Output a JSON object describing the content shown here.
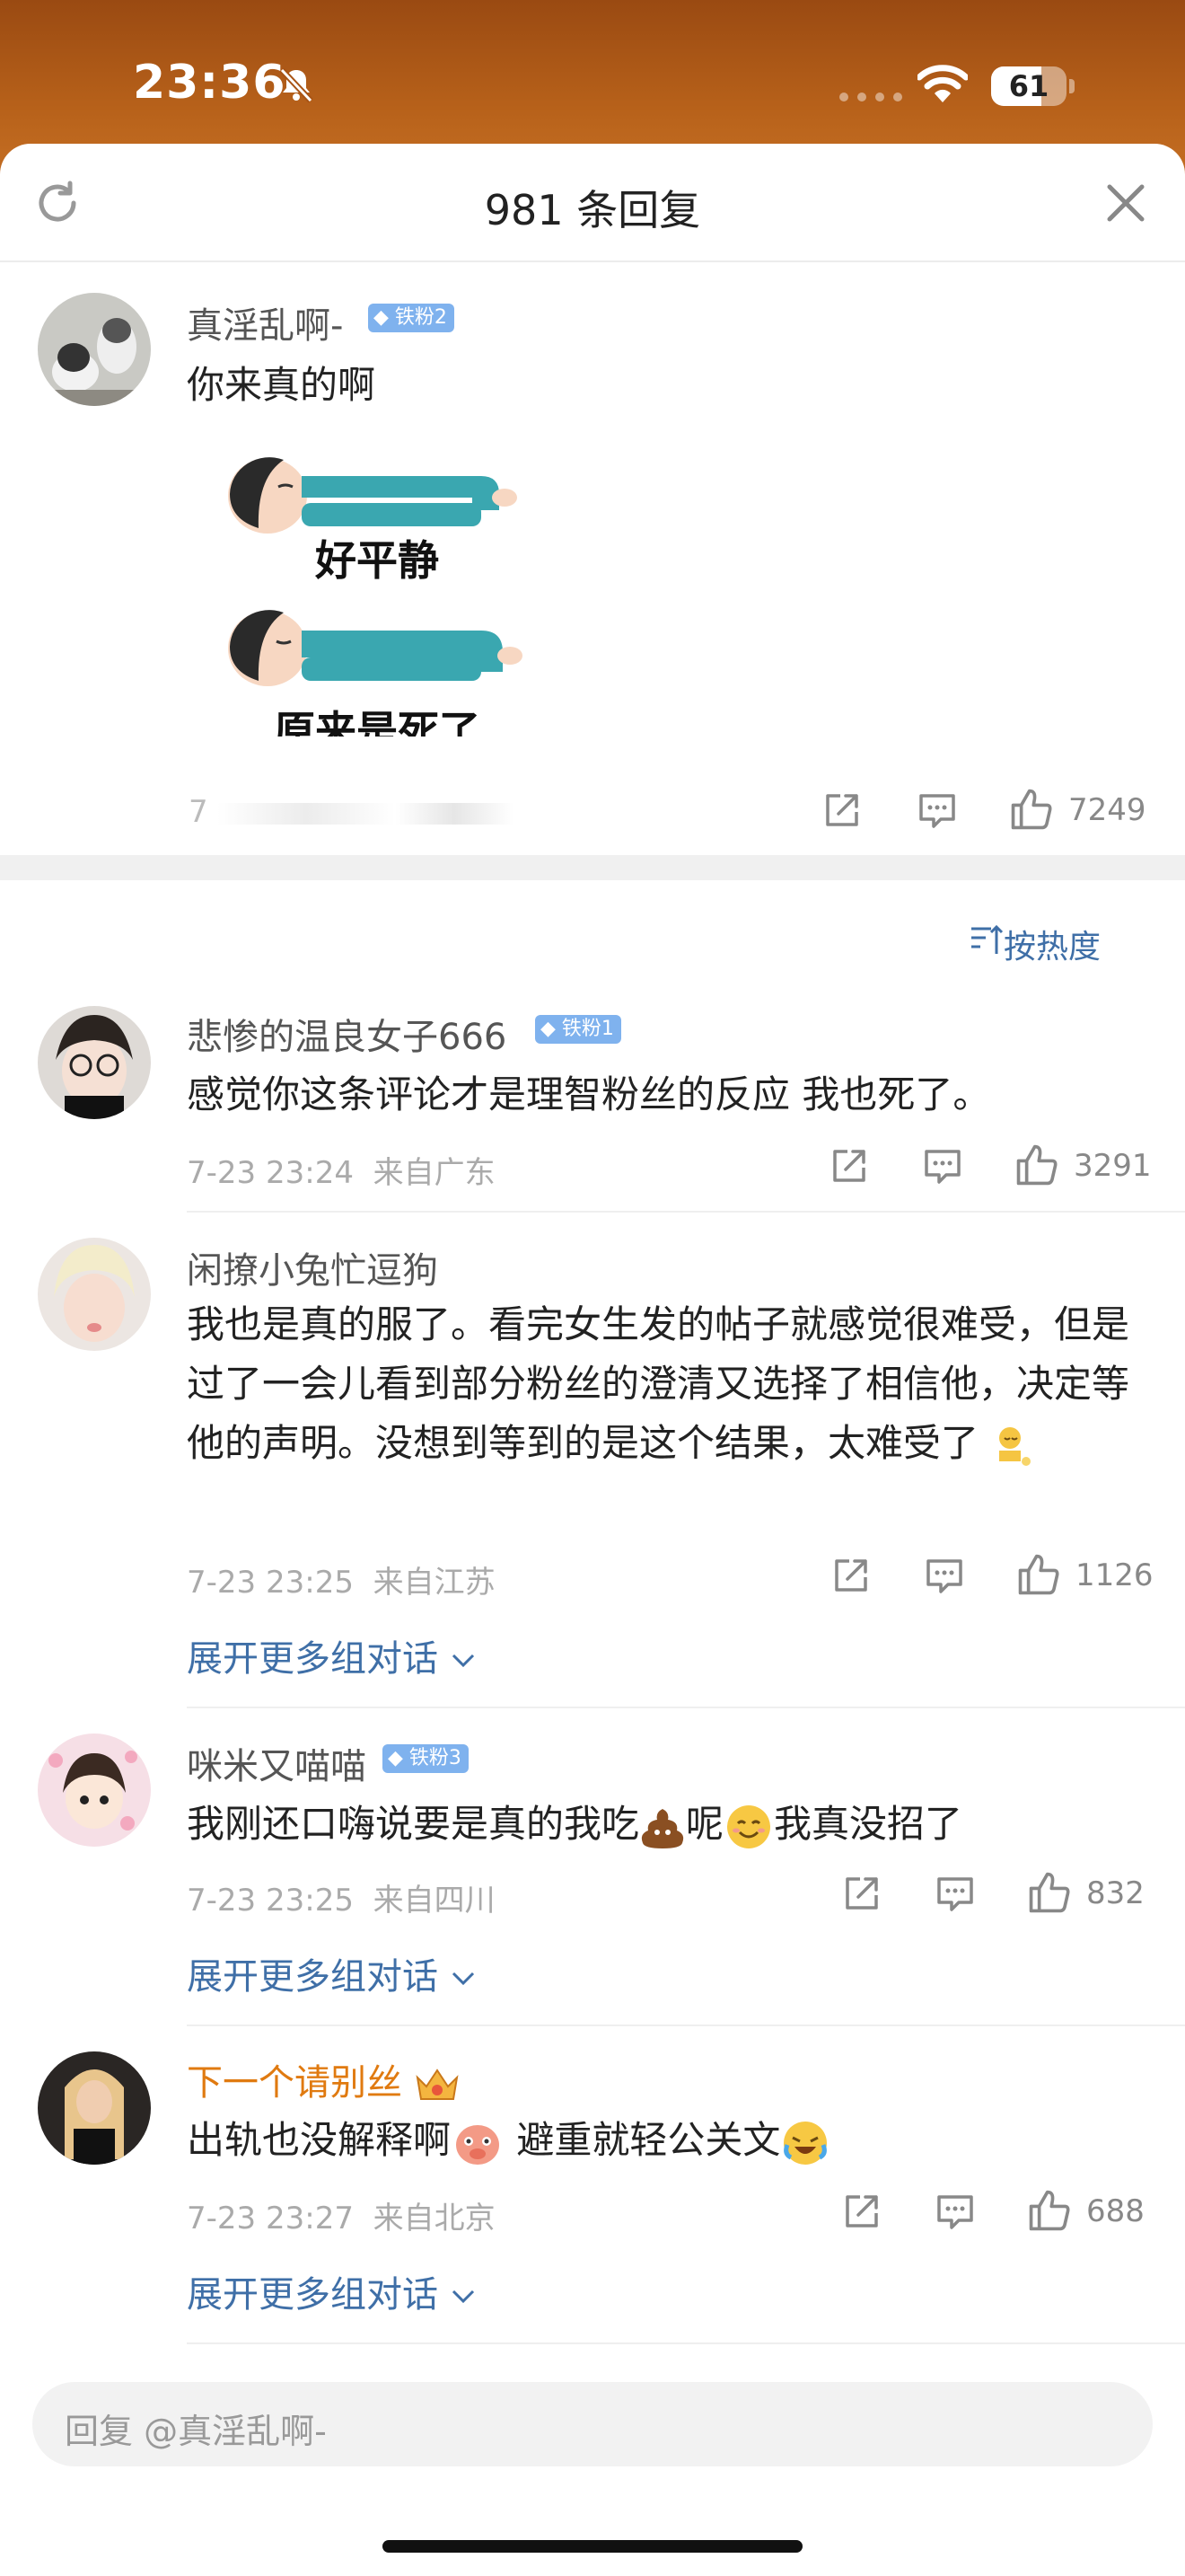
{
  "status_bar": {
    "time": "23:36",
    "battery": "61"
  },
  "header": {
    "title": "981 条回复"
  },
  "main_comment": {
    "user": "真淫乱啊-",
    "badge": "铁粉2",
    "text": "你来真的啊",
    "sticker_caption_1": "好平静",
    "sticker_caption_2": "原来是死了",
    "meta_obscured": "7",
    "likes": "7249"
  },
  "sort": {
    "label": "按热度"
  },
  "replies": [
    {
      "user": "悲惨的温良女子666",
      "badge": "铁粉1",
      "text": "感觉你这条评论才是理智粉丝的反应 我也死了。",
      "time": "7-23 23:24",
      "location": "来自广东",
      "likes": "3291"
    },
    {
      "user": "闲撩小兔忙逗狗",
      "text": "我也是真的服了。看完女生发的帖子就感觉很难受，但是过了一会儿看到部分粉丝的澄清又选择了相信他，决定等他的声明。没想到等到的是这个结果，太难受了",
      "time": "7-23 23:25",
      "location": "来自江苏",
      "likes": "1126",
      "expand": "展开更多组对话"
    },
    {
      "user": "咪米又喵喵",
      "badge": "铁粉3",
      "text_a": "我刚还口嗨说要是真的我吃",
      "text_b": "呢",
      "text_c": "我真没招了",
      "time": "7-23 23:25",
      "location": "来自四川",
      "likes": "832",
      "expand": "展开更多组对话"
    },
    {
      "user": "下一个请别丝",
      "text_a": "出轨也没解释啊",
      "text_b": "避重就轻公关文",
      "time": "7-23 23:27",
      "location": "来自北京",
      "likes": "688",
      "expand": "展开更多组对话"
    }
  ],
  "reply_input": {
    "placeholder": "回复 @真淫乱啊-"
  },
  "colors": {
    "link": "#3f6fa7",
    "badge": "#7fb2ee",
    "highlight_user": "#e07a10"
  }
}
